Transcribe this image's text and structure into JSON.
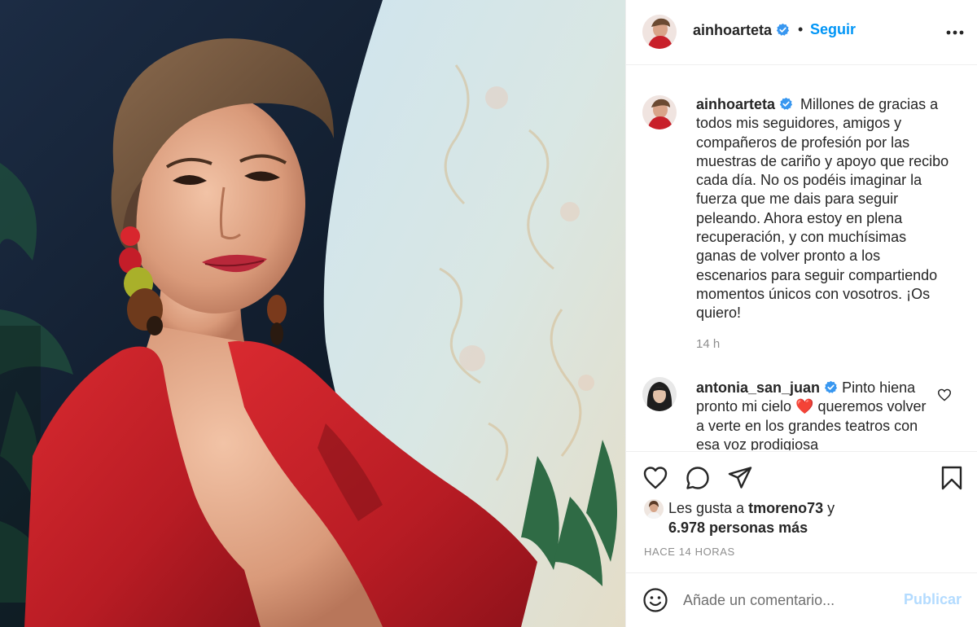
{
  "post": {
    "username": "ainhoarteta",
    "verified": true,
    "follow_label": "Seguir",
    "separator": "•",
    "more_icon": "more-horizontal-icon"
  },
  "caption": {
    "username": "ainhoarteta",
    "text": "Millones de gracias a todos mis seguidores, amigos y compañeros de profesión por las muestras de cariño y apoyo que recibo cada día. No os podéis imaginar la fuerza que me dais para seguir peleando. Ahora estoy en plena recuperación, y con muchísimas ganas de volver pronto a los escenarios para seguir compartiendo momentos únicos con vosotros. ¡Os quiero!",
    "time": "14 h"
  },
  "comments": [
    {
      "username": "antonia_san_juan",
      "verified": true,
      "text": "Pinto hiena pronto mi cielo ❤️ queremos volver a verte en los grandes teatros con esa voz prodigiosa"
    }
  ],
  "actions": {
    "like_icon": "heart-icon",
    "comment_icon": "comment-icon",
    "share_icon": "paper-plane-icon",
    "save_icon": "bookmark-icon"
  },
  "likes": {
    "prefix": "Les gusta a ",
    "user": "tmoreno73",
    "connector": " y",
    "others": "6.978 personas más"
  },
  "timestamp": "HACE 14 HORAS",
  "add_comment": {
    "placeholder": "Añade un comentario...",
    "publish_label": "Publicar",
    "emoji_icon": "smiley-icon"
  },
  "colors": {
    "accent": "#0095f6",
    "verified": "#3897f0",
    "publish_disabled": "#b3dbff",
    "muted": "#8e8e8e",
    "dress_red": "#c8202a"
  }
}
